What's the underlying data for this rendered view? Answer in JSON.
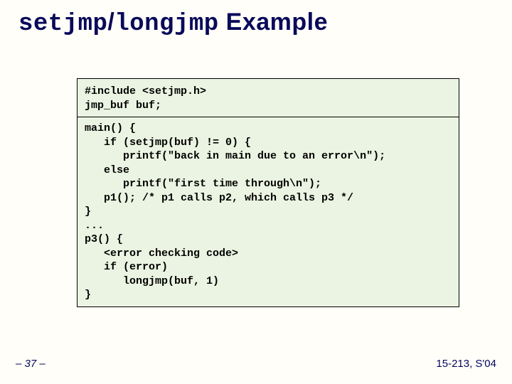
{
  "title": {
    "mono1": "setjmp",
    "slash": "/",
    "mono2": "longjmp",
    "rest": " Example"
  },
  "code": {
    "header": "#include <setjmp.h>\njmp_buf buf;",
    "body": "main() {\n   if (setjmp(buf) != 0) {\n      printf(\"back in main due to an error\\n\");\n   else\n      printf(\"first time through\\n\");\n   p1(); /* p1 calls p2, which calls p3 */\n}\n...\np3() {\n   <error checking code>\n   if (error)\n      longjmp(buf, 1)\n}"
  },
  "footer": {
    "slide_number": "– 37 –",
    "course": "15-213, S'04"
  }
}
